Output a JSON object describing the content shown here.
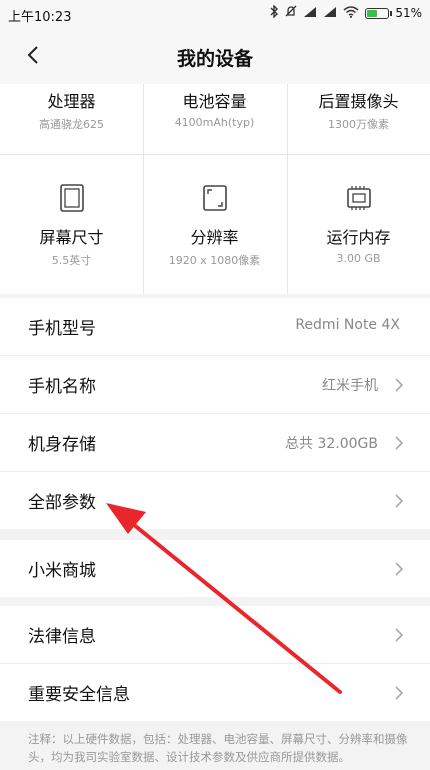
{
  "status_bar": {
    "time": "上午10:23",
    "battery_percent": "51%",
    "battery_level": 0.51
  },
  "header": {
    "title": "我的设备"
  },
  "specs": {
    "processor": {
      "title": "处理器",
      "value": "高通骁龙625"
    },
    "battery": {
      "title": "电池容量",
      "value": "4100mAh(typ)"
    },
    "rear_camera": {
      "title": "后置摄像头",
      "value": "1300万像素"
    },
    "screen_size": {
      "title": "屏幕尺寸",
      "value": "5.5英寸"
    },
    "resolution": {
      "title": "分辨率",
      "value": "1920 x 1080像素"
    },
    "ram": {
      "title": "运行内存",
      "value": "3.00 GB"
    }
  },
  "list1": {
    "model": {
      "label": "手机型号",
      "value": "Redmi Note 4X"
    },
    "name": {
      "label": "手机名称",
      "value": "红米手机"
    },
    "storage": {
      "label": "机身存储",
      "value": "总共 32.00GB"
    },
    "all_params": {
      "label": "全部参数"
    }
  },
  "list2": {
    "mi_store": {
      "label": "小米商城"
    }
  },
  "list3": {
    "legal": {
      "label": "法律信息"
    },
    "safety": {
      "label": "重要安全信息"
    }
  },
  "footnote": {
    "text": "注释：以上硬件数据，包括：处理器、电池容量、屏幕尺寸、分辨率和摄像头，均为我司实验室数据、设计技术参数及供应商所提供数据。"
  },
  "colors": {
    "annotation_arrow": "#e8262b",
    "battery_fill": "#3bbf4a"
  }
}
